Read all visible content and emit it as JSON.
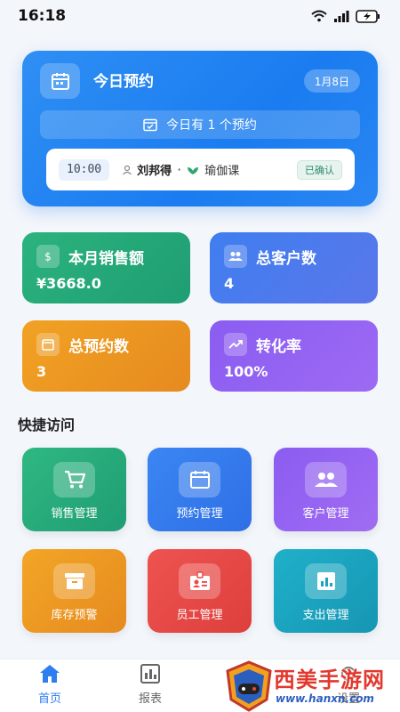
{
  "status_bar": {
    "time": "16:18"
  },
  "appointment": {
    "title": "今日预约",
    "date": "1月8日",
    "summary": "今日有 1 个预约",
    "item": {
      "time": "10:00",
      "customer": "刘邦得",
      "separator": "·",
      "service": "瑜伽课",
      "status": "已确认"
    }
  },
  "stats": [
    {
      "label": "本月销售额",
      "value": "¥3668.0",
      "icon": "dollar-icon"
    },
    {
      "label": "总客户数",
      "value": "4",
      "icon": "people-icon"
    },
    {
      "label": "总预约数",
      "value": "3",
      "icon": "calendar-icon"
    },
    {
      "label": "转化率",
      "value": "100%",
      "icon": "trend-icon"
    }
  ],
  "quick_access": {
    "title": "快捷访问",
    "items": [
      {
        "label": "销售管理",
        "icon": "cart-icon"
      },
      {
        "label": "预约管理",
        "icon": "calendar-icon"
      },
      {
        "label": "客户管理",
        "icon": "people-icon"
      },
      {
        "label": "库存预警",
        "icon": "archive-icon"
      },
      {
        "label": "员工管理",
        "icon": "badge-icon"
      },
      {
        "label": "支出管理",
        "icon": "bar-chart-icon"
      }
    ]
  },
  "bottom_nav": {
    "items": [
      {
        "label": "首页",
        "icon": "home-icon",
        "active": true
      },
      {
        "label": "报表",
        "icon": "report-icon",
        "active": false
      },
      {
        "label": "设置",
        "icon": "settings-icon",
        "active": false
      }
    ]
  },
  "watermark": {
    "text": "西美手游网",
    "url": "www.hanxn.com"
  },
  "colors": {
    "accent": "#2f7ef0",
    "green": "#1f9d73",
    "orange": "#e68a1f",
    "purple": "#8a5cf1",
    "red": "#dc3f3c",
    "teal": "#1696b3"
  }
}
